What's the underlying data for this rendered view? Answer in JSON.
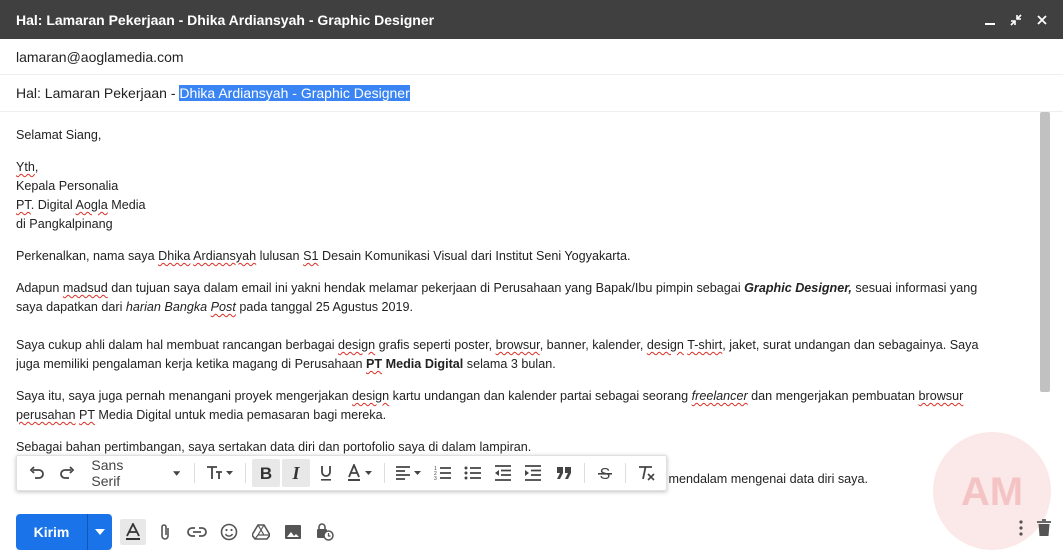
{
  "window": {
    "title": "Hal: Lamaran Pekerjaan - Dhika Ardiansyah - Graphic Designer",
    "controls": [
      "minimize-icon",
      "exit-fullscreen-icon",
      "close-icon"
    ]
  },
  "to": "lamaran@aoglamedia.com",
  "subject": {
    "prefix": "Hal: Lamaran Pekerjaan - ",
    "selected": "Dhika Ardiansyah - Graphic Designer"
  },
  "body": {
    "greeting": "Selamat Siang,",
    "addr": {
      "yth": "Yth",
      "yth_tail": ",",
      "l2": "Kepala Personalia",
      "l3_sq": "PT",
      "l3_rest": ". Digital ",
      "l3_sq2": "Aogla",
      "l3_tail": " Media",
      "l4": "di Pangkalpinang"
    },
    "p1": {
      "a": "Perkenalkan, nama saya ",
      "b": "Dhika",
      "c": " ",
      "d": "Ardiansyah",
      "e": " lulusan ",
      "f": "S1",
      "g": " Desain Komunikasi Visual dari Institut Seni Yogyakarta."
    },
    "p2": {
      "a": "Adapun ",
      "b": "madsud",
      "c": " dan tujuan saya dalam email ini yakni hendak melamar pekerjaan di Perusahaan yang Bapak/Ibu pimpin sebagai ",
      "d": "Graphic Designer,",
      "e": " sesuai informasi yang",
      "f": "saya dapatkan dari ",
      "g": "harian Bangka ",
      "h": "Post",
      "i": " pada tanggal 25 Agustus 2019."
    },
    "p3": {
      "a": "Saya cukup ahli dalam hal membuat rancangan berbagai ",
      "b": "design",
      "c": " grafis seperti poster, ",
      "d": "browsur",
      "e": ", banner, kalender, ",
      "f": "design",
      "g": " ",
      "h": "T-shirt",
      "i": ", jaket, surat undangan dan sebagainya. Saya",
      "j": "juga memiliki pengalaman kerja ketika magang di Perusahaan ",
      "k": "PT",
      "l": " Media Digital",
      "m": " selama 3 bulan."
    },
    "p4": {
      "a": "Saya itu, saya juga pernah menangani proyek mengerjakan ",
      "b": "design",
      "c": " kartu undangan dan kalender partai sebagai seorang ",
      "d": "freelancer",
      "e": " dan mengerjakan pembuatan ",
      "f": "browsur",
      "g": "perusahan",
      "h": " ",
      "i": "PT",
      "j": " Media Digital untuk media pemasaran bagi mereka."
    },
    "p5_partial": "Sebagai bahan pertimbangan, saya sertakan data diri dan portofolio saya di dalam lampiran.",
    "p6": "Besar harapan saya agar bisa diberikan kesempatan untuk menghadiri tes wawancara kerja guna menjelaskan lebih mendalam mengenai data diri saya."
  },
  "format_toolbar": {
    "font": "Sans Serif",
    "icons": [
      "undo-icon",
      "redo-icon",
      "text-size-icon",
      "bold-icon",
      "italic-icon",
      "underline-icon",
      "text-color-icon",
      "align-icon",
      "numbered-list-icon",
      "bulleted-list-icon",
      "indent-less-icon",
      "indent-more-icon",
      "quote-icon",
      "strikethrough-icon",
      "remove-formatting-icon"
    ]
  },
  "bottom_bar": {
    "send_label": "Kirim",
    "icons": [
      "formatting-options-icon",
      "attach-icon",
      "link-icon",
      "emoji-icon",
      "drive-icon",
      "photo-icon",
      "confidential-icon"
    ],
    "right_icons": [
      "more-options-icon",
      "trash-icon"
    ]
  },
  "watermark_text": "AM",
  "colors": {
    "titlebar": "#404040",
    "send": "#1a73e8",
    "selection": "#3a85f3"
  }
}
